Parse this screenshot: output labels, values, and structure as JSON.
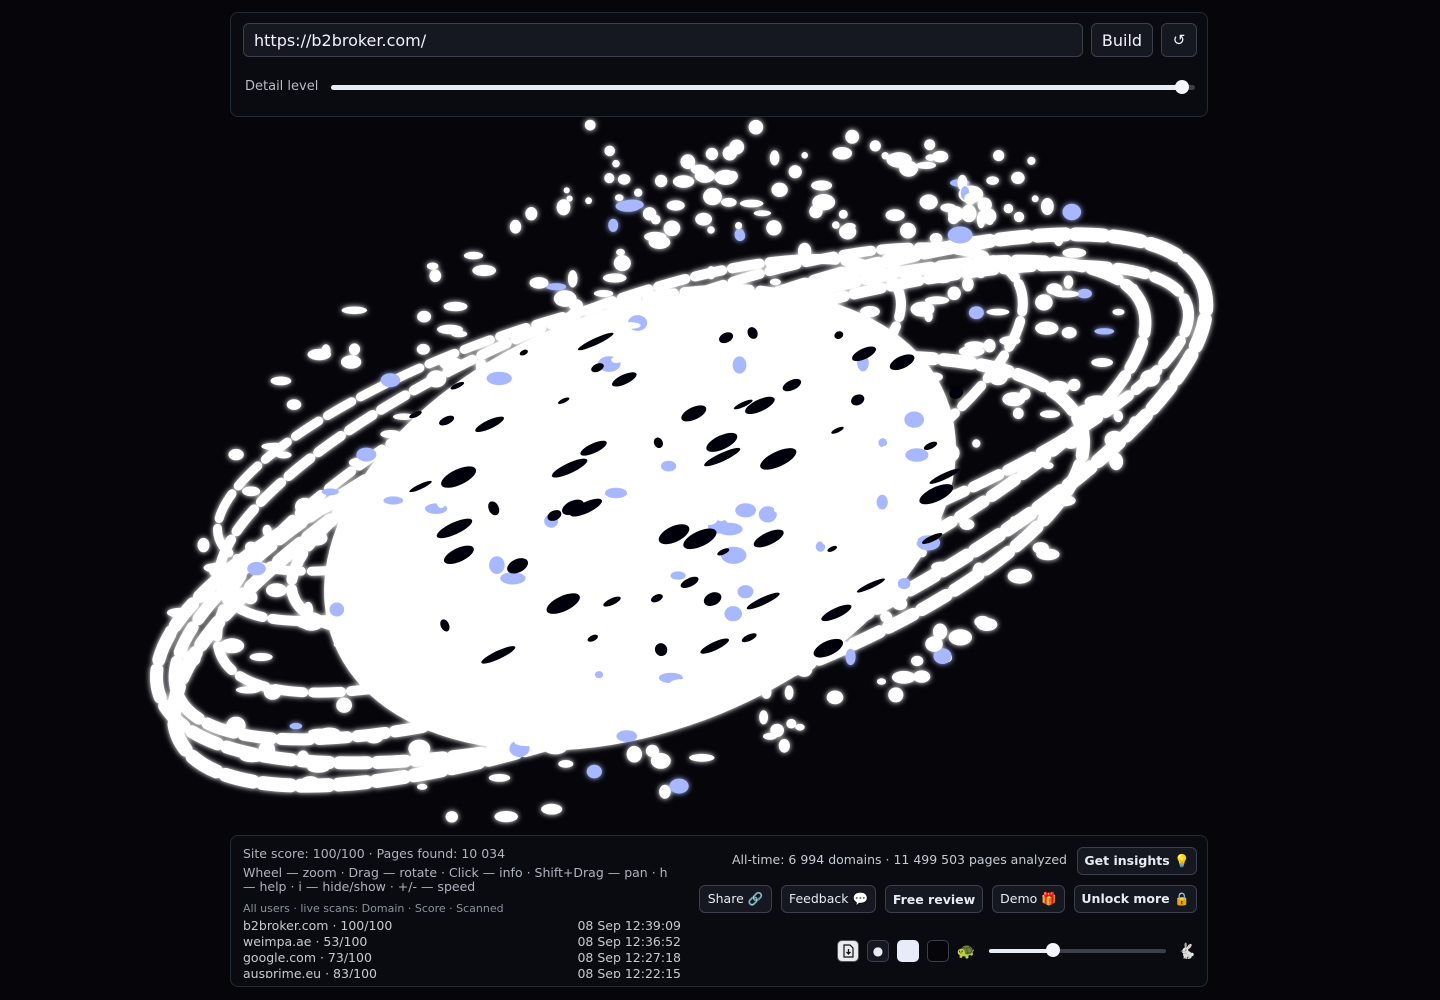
{
  "toolbar": {
    "url_value": "https://b2broker.com/",
    "build_label": "Build",
    "reset_icon": "↺",
    "detail_label": "Detail level",
    "detail_level": 0.985
  },
  "status": {
    "site_score": "Site score: 100/100 · Pages found: 10 034",
    "help": "Wheel — zoom · Drag — rotate · Click — info · Shift+Drag — pan · h — help · i — hide/show · +/- — speed",
    "live_header": "All users · live scans: Domain · Score · Scanned",
    "alltime": "All-time: 6 994 domains · 11 499 503 pages analyzed"
  },
  "scans": [
    {
      "domain": "b2broker.com · 100/100",
      "time": "08 Sep 12:39:09"
    },
    {
      "domain": "weimpa.ae · 53/100",
      "time": "08 Sep 12:36:52"
    },
    {
      "domain": "google.com · 73/100",
      "time": "08 Sep 12:27:18"
    },
    {
      "domain": "ausprime.eu · 83/100",
      "time": "08 Sep 12:22:15"
    }
  ],
  "actions": {
    "get_insights": "Get insights 💡",
    "share": "Share 🔗",
    "feedback": "Feedback 💬",
    "free_review": "Free review",
    "demo": "Demo 🎁",
    "unlock_more": "Unlock more 🔒"
  },
  "controls": {
    "download_icon": "download-icon",
    "dot_icon": "●",
    "slow_icon": "🐢",
    "fast_icon": "🐇",
    "speed_level": 0.36
  },
  "colors": {
    "background": "#05050a",
    "glow": "#ffffff",
    "glow_edge": "#a8b8ff"
  }
}
